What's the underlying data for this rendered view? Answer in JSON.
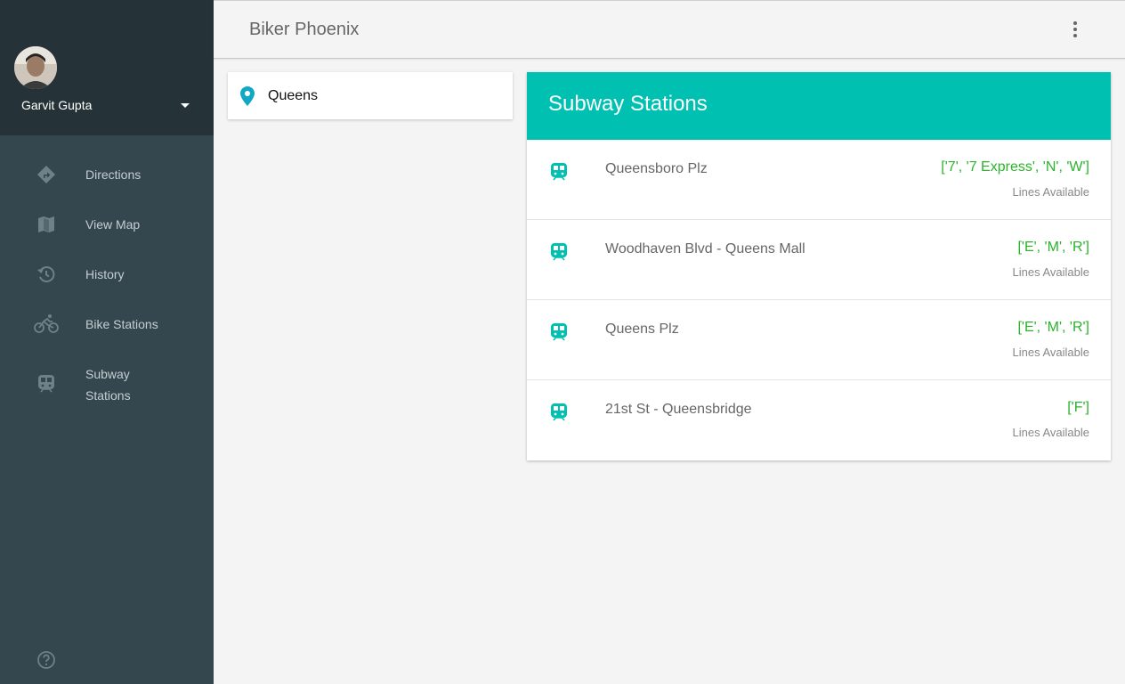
{
  "app": {
    "title": "Biker Phoenix"
  },
  "user": {
    "name": "Garvit Gupta"
  },
  "sidebar": {
    "items": [
      {
        "label": "Directions",
        "icon": "directions-icon"
      },
      {
        "label": "View Map",
        "icon": "map-icon"
      },
      {
        "label": "History",
        "icon": "history-icon"
      },
      {
        "label": "Bike Stations",
        "icon": "bike-icon"
      },
      {
        "label": "Subway Stations",
        "icon": "subway-icon"
      }
    ]
  },
  "search": {
    "value": "Queens",
    "icon": "location-pin-icon"
  },
  "results": {
    "title": "Subway Stations",
    "caption": "Lines Available",
    "stations": [
      {
        "name": "Queensboro Plz",
        "lines": "['7', '7 Express', 'N', 'W']"
      },
      {
        "name": "Woodhaven Blvd - Queens Mall",
        "lines": "['E', 'M', 'R']"
      },
      {
        "name": "Queens Plz",
        "lines": "['E', 'M', 'R']"
      },
      {
        "name": "21st St - Queensbridge",
        "lines": "['F']"
      }
    ]
  },
  "colors": {
    "accent": "#00c1b1",
    "lines_text": "#2bb32b",
    "sidebar": "#34474f",
    "sidebar_header": "#253338"
  }
}
